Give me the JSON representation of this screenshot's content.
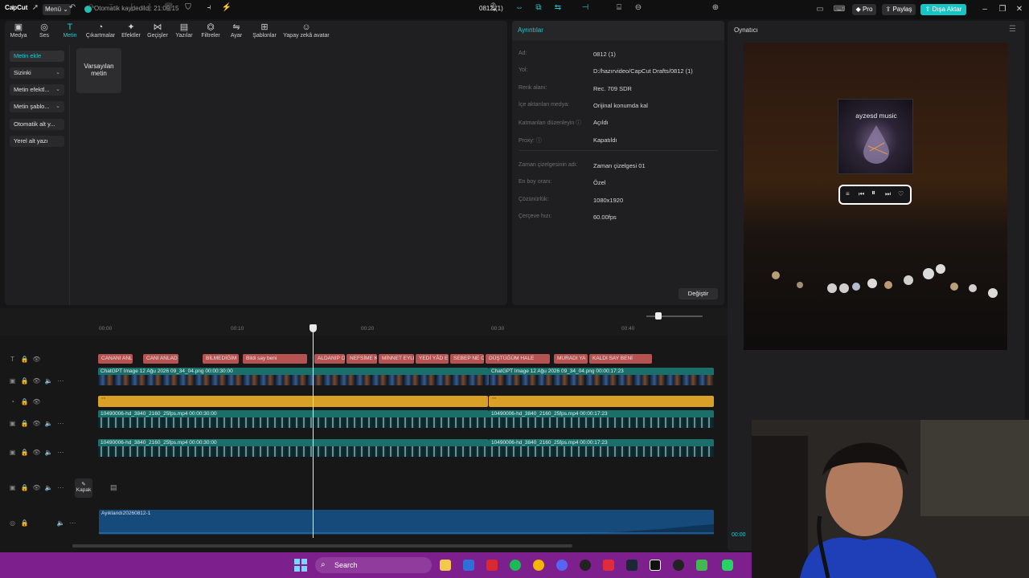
{
  "titlebar": {
    "logo": "CapCut",
    "menu_label": "Menü",
    "autosave_text": "Otomatik kaydedildi: 21:09:15",
    "project_title": "0812 (1)",
    "pro_label": "Pro",
    "share_label": "Paylaş",
    "export_label": "Dışa Aktar"
  },
  "toolbar": [
    {
      "label": "Medya",
      "icon": "media-icon"
    },
    {
      "label": "Ses",
      "icon": "audio-icon"
    },
    {
      "label": "Metin",
      "icon": "text-icon"
    },
    {
      "label": "Çıkartmalar",
      "icon": "sticker-icon"
    },
    {
      "label": "Efektler",
      "icon": "effects-icon"
    },
    {
      "label": "Geçişler",
      "icon": "transitions-icon"
    },
    {
      "label": "Yazılar",
      "icon": "captions-icon"
    },
    {
      "label": "Filtreler",
      "icon": "filters-icon"
    },
    {
      "label": "Ayar",
      "icon": "adjust-icon"
    },
    {
      "label": "Şablonlar",
      "icon": "templates-icon"
    },
    {
      "label": "Yapay zekâ avatar",
      "icon": "ai-avatar-icon"
    }
  ],
  "sidebar": {
    "items": [
      {
        "label": "Metin ekle"
      },
      {
        "label": "Sizinki"
      },
      {
        "label": "Metin efektl..."
      },
      {
        "label": "Metin şablo..."
      },
      {
        "label": "Otomatik alt y..."
      },
      {
        "label": "Yerel alt yazı"
      }
    ]
  },
  "content": {
    "default_text_line1": "Varsayılan",
    "default_text_line2": "metin"
  },
  "details": {
    "title": "Ayrıntılar",
    "rows": [
      {
        "label": "Ad:",
        "value": "0812 (1)"
      },
      {
        "label": "Yol:",
        "value": "D:/hazırvideo/CapCut Drafts/0812 (1)"
      },
      {
        "label": "Renk alanı:",
        "value": "Rec. 709 SDR"
      },
      {
        "label": "İçe aktarılan medya:",
        "value": "Orijinal konumda kal"
      },
      {
        "label": "Katmanları düzenleyin ⓘ",
        "value": "Açıldı"
      },
      {
        "label": "Proxy: ⓘ",
        "value": "Kapatıldı"
      },
      {
        "label": "Zaman çizelgesinin adı:",
        "value": "Zaman çizelgesi 01"
      },
      {
        "label": "En boy oranı:",
        "value": "Özel"
      },
      {
        "label": "Çözünürlük:",
        "value": "1080x1920"
      },
      {
        "label": "Çerçeve hızı:",
        "value": "60.00fps"
      }
    ],
    "change_label": "Değiştir"
  },
  "player": {
    "title": "Oynatıcı",
    "cover_title": "ayzesd music",
    "time_partial": "00:00"
  },
  "timeline": {
    "ticks": [
      "00:00",
      "00:10",
      "00:20",
      "00:30",
      "00:40"
    ],
    "text_clips": [
      "CANANI ANL",
      "CANI ANLAD",
      "BİLMEDİĞİM",
      "Bildi say beni",
      "ALDANIP O",
      "NEFSİME K",
      "MİNNET EYLE",
      "YEDİ YÂD E",
      "SEBEP NE O",
      "DÜŞTÜĞÜM HALE",
      "MURADI YA",
      "KALDI SAY BENİ"
    ],
    "video_clips": [
      {
        "label": "ChatGPT Image 12 Ağu 2026 09_34_04.png  00:00:30:00"
      },
      {
        "label": "ChatGPT Image 12 Ağu 2026 09_34_04.png  00:00:17:23"
      }
    ],
    "orange_labels": [
      "◦◦",
      "◦◦"
    ],
    "main_clips": [
      {
        "label": "10490006-hd_3840_2160_25fps.mp4   00:00:30:00"
      },
      {
        "label": "10490006-hd_3840_2160_25fps.mp4   00:00:17:23"
      }
    ],
    "cover_label": "Kapak",
    "audio_label": "Ayıklandı20260812-1"
  },
  "taskbar": {
    "search_placeholder": "Search"
  }
}
